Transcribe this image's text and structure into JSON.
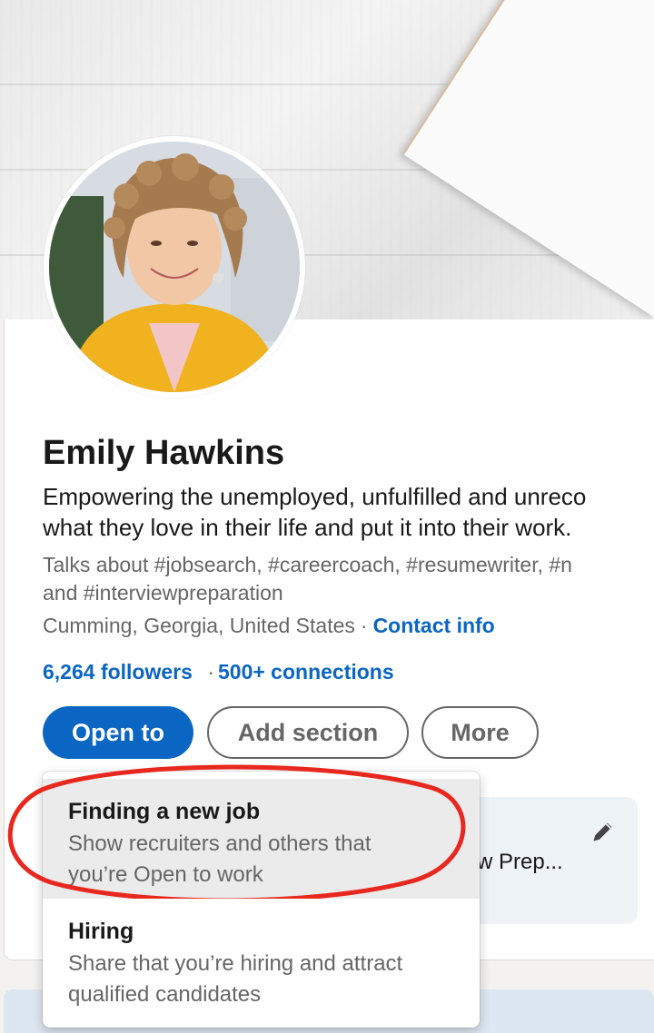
{
  "profile": {
    "name": "Emily Hawkins",
    "headline_line1": "Empowering the unemployed, unfulfilled and unreco",
    "headline_line2": "what they love in their life and put it into their work.",
    "talks_line1": "Talks about #jobsearch, #careercoach, #resumewriter, #n",
    "talks_line2": "and #interviewpreparation",
    "location": "Cumming, Georgia, United States",
    "separator": "·",
    "contact_link": "Contact info",
    "followers": "6,264 followers",
    "connections": "500+ connections"
  },
  "actions": {
    "open_to": "Open to",
    "add_section": "Add section",
    "more": "More"
  },
  "dropdown": {
    "items": [
      {
        "title": "Finding a new job",
        "desc": "Show recruiters and others that\nyou’re Open to work"
      },
      {
        "title": "Hiring",
        "desc": "Share that you’re hiring and attract\nqualified candidates"
      }
    ]
  },
  "background_card": {
    "text": "w Prep..."
  },
  "colors": {
    "brand_blue": "#0a66c2",
    "annotation_red": "#e8281e",
    "highlight_bg": "#ebebeb"
  },
  "icons": [
    "pencil-icon"
  ]
}
